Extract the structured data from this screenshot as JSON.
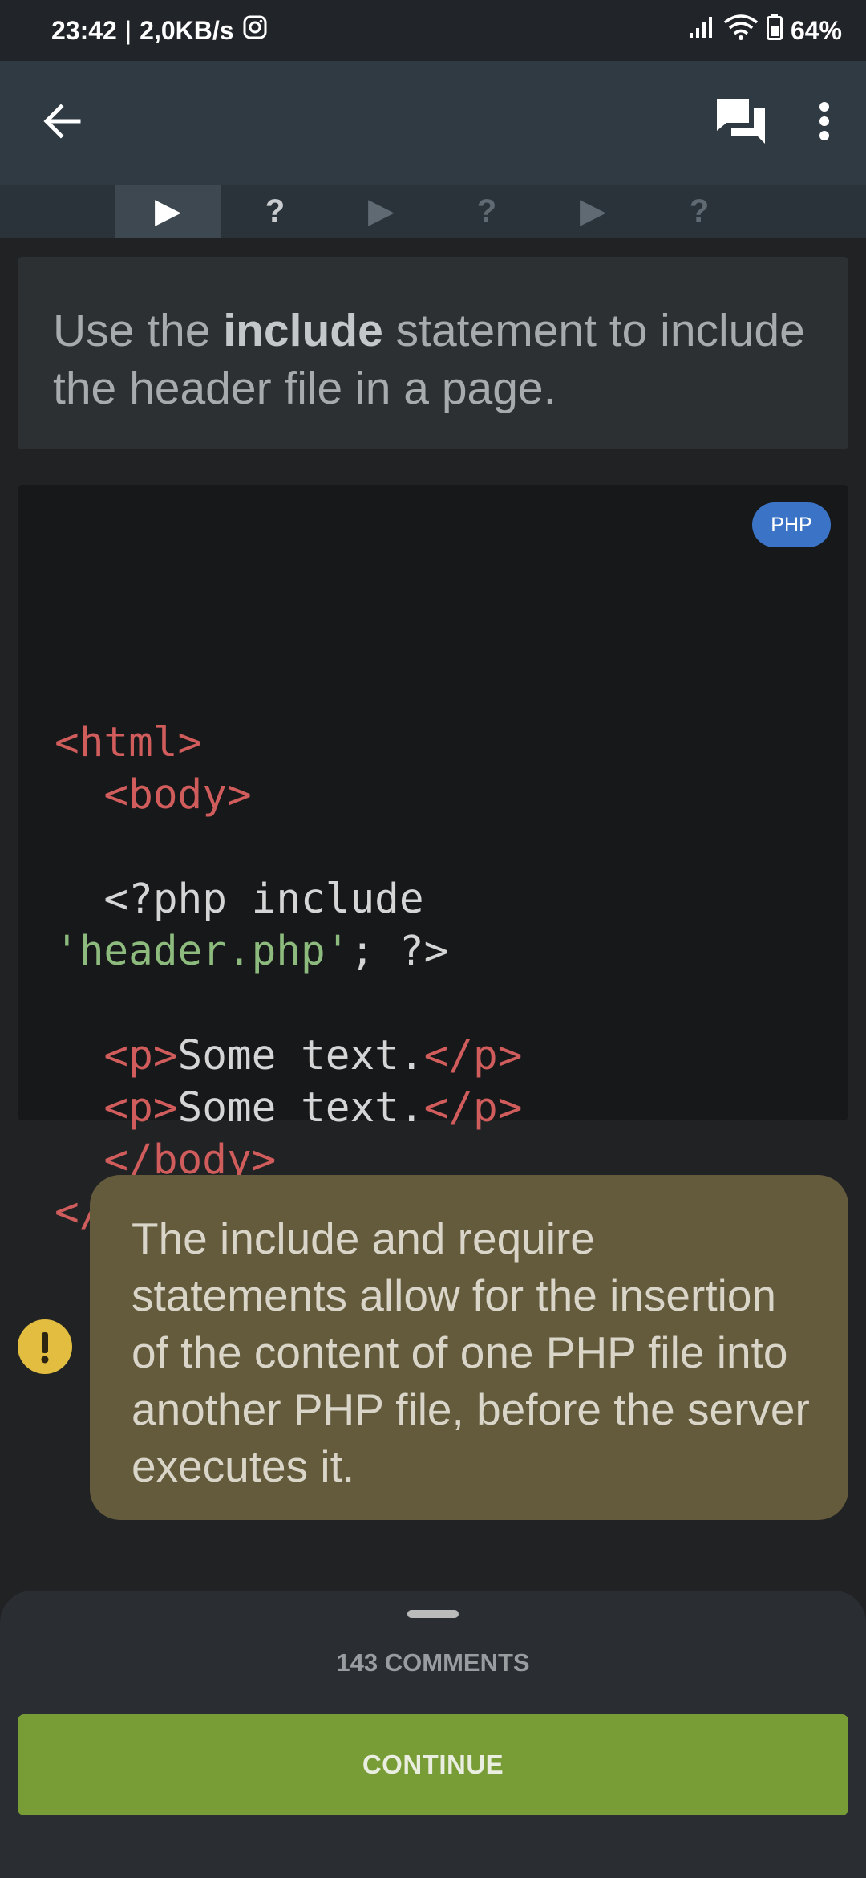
{
  "status_bar": {
    "time": "23:42",
    "network_speed": "2,0KB/s",
    "battery": "64%",
    "icons": [
      "instagram-icon",
      "signal-icon",
      "wifi-icon",
      "battery-icon"
    ]
  },
  "app_bar": {
    "icons": [
      "back-arrow-icon",
      "comments-icon",
      "more-vert-icon"
    ]
  },
  "steps": [
    {
      "symbol": "▶",
      "type": "lesson",
      "active": true
    },
    {
      "symbol": "?",
      "type": "quiz",
      "active": false
    },
    {
      "symbol": "▶",
      "type": "lesson",
      "active": false
    },
    {
      "symbol": "?",
      "type": "quiz",
      "active": false
    },
    {
      "symbol": "▶",
      "type": "lesson",
      "active": false
    },
    {
      "symbol": "?",
      "type": "quiz",
      "active": false
    }
  ],
  "instruction": {
    "before": "Use the ",
    "bold": "include",
    "after": " statement to include the header file in a page."
  },
  "code_block": {
    "language_badge": "PHP",
    "lines": [
      [
        {
          "t": "<html>",
          "c": "tag"
        }
      ],
      [
        {
          "t": "  ",
          "c": "txt"
        },
        {
          "t": "<body>",
          "c": "tag"
        }
      ],
      [
        {
          "t": "",
          "c": "txt"
        }
      ],
      [
        {
          "t": "  <?php include",
          "c": "txt"
        }
      ],
      [
        {
          "t": "'header.php'",
          "c": "str"
        },
        {
          "t": "; ?>",
          "c": "txt"
        }
      ],
      [
        {
          "t": "",
          "c": "txt"
        }
      ],
      [
        {
          "t": "  ",
          "c": "txt"
        },
        {
          "t": "<p>",
          "c": "tag"
        },
        {
          "t": "Some text.",
          "c": "txt"
        },
        {
          "t": "</p>",
          "c": "tag"
        }
      ],
      [
        {
          "t": "  ",
          "c": "txt"
        },
        {
          "t": "<p>",
          "c": "tag"
        },
        {
          "t": "Some text.",
          "c": "txt"
        },
        {
          "t": "</p>",
          "c": "tag"
        }
      ],
      [
        {
          "t": "  ",
          "c": "txt"
        },
        {
          "t": "</body>",
          "c": "tag"
        }
      ],
      [
        {
          "t": "</html>",
          "c": "tag"
        }
      ]
    ]
  },
  "note": {
    "icon": "exclamation-icon",
    "text": "The include and require statements allow for the insertion of the content of one PHP file into another PHP file, before the server executes it."
  },
  "bottom_sheet": {
    "comments_label": "143 COMMENTS",
    "continue_label": "CONTINUE"
  },
  "colors": {
    "accent_green": "#789d37",
    "php_badge": "#3b74c6",
    "note_bg": "#645a3c",
    "warning_yellow": "#e2bd3f",
    "code_tag": "#d05c5c",
    "code_string": "#8dbb7d"
  }
}
